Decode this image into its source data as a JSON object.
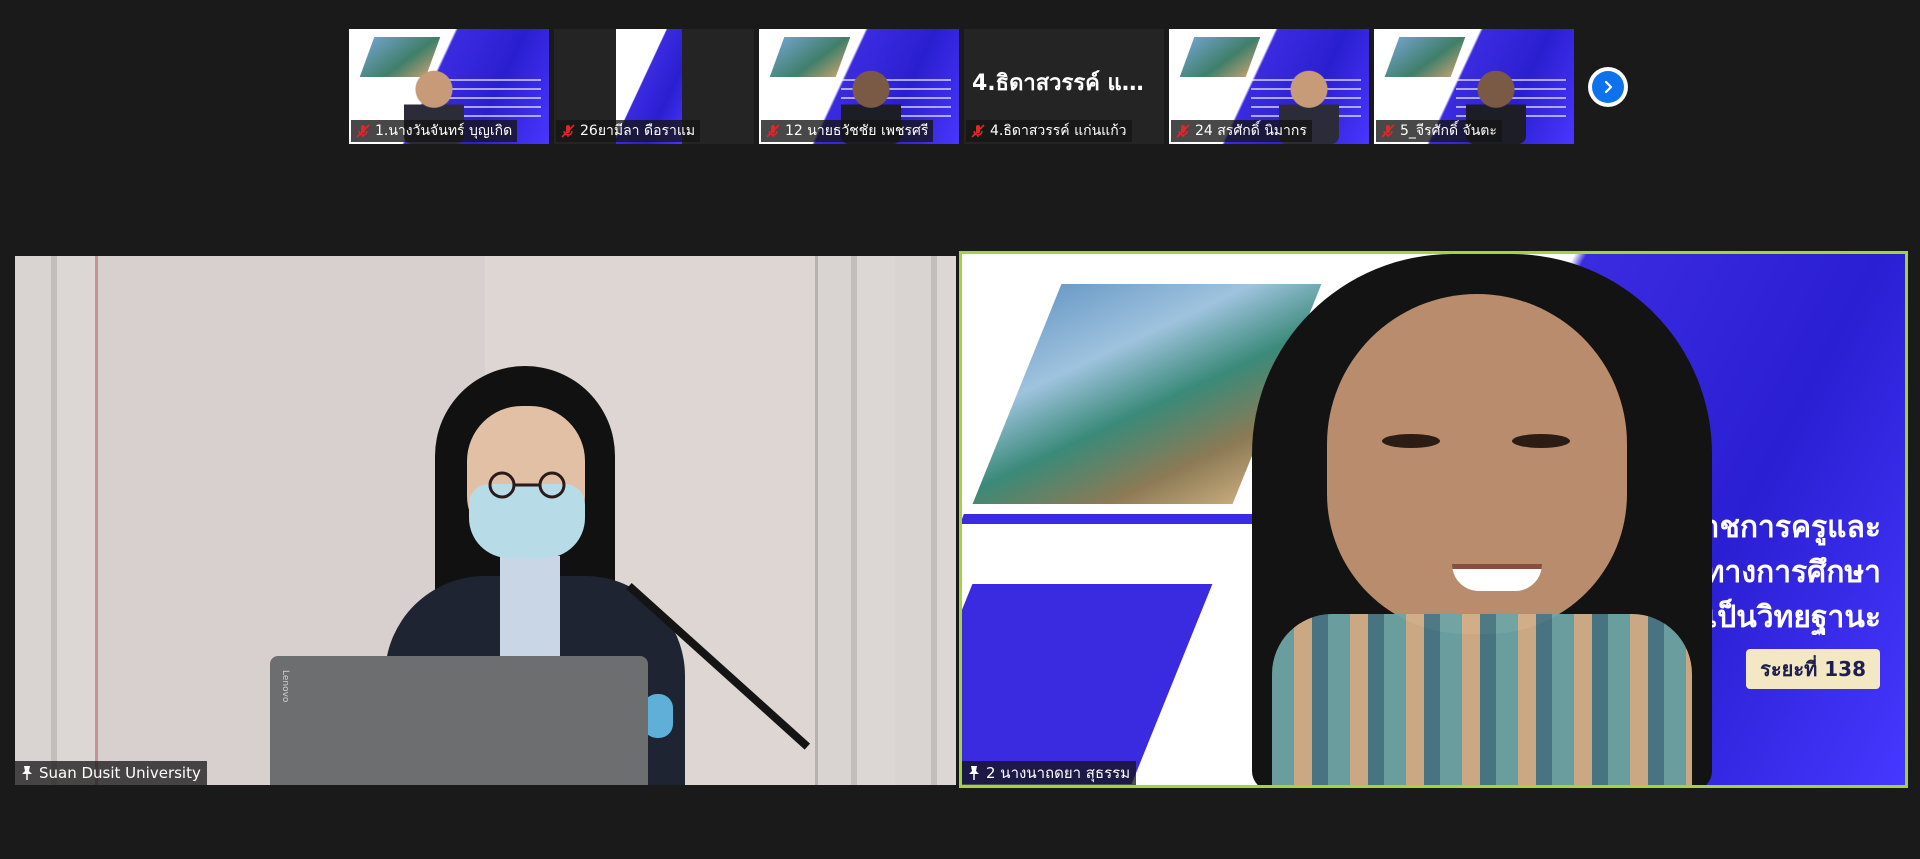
{
  "strip": {
    "participants": [
      {
        "name": "1.นางวันจันทร์ บุญเกิด",
        "mic": "muted-mic-icon"
      },
      {
        "name": "26ยามีลา ดือราแม",
        "mic": "muted-mic-icon"
      },
      {
        "name": "12 นายธวัชชัย เพชรศรี",
        "mic": "muted-mic-icon"
      },
      {
        "name": "4.ธิดาสวรรค์ แก่นแก้ว",
        "mic": "muted-mic-icon",
        "tile_title": "4.ธิดาสวรรค์ แก่..."
      },
      {
        "name": "24 สรศักดิ์ นิมากร",
        "mic": "muted-mic-icon"
      },
      {
        "name": "5_จีรศักดิ์ จันตะ",
        "mic": "muted-mic-icon"
      }
    ],
    "next_button_icon": "chevron-right-icon"
  },
  "main": {
    "left": {
      "name": "Suan Dusit University",
      "icon": "pin-icon",
      "laptop_brand": "Lenovo"
    },
    "right": {
      "name": "2 นางนาถดยา สุธรรม",
      "icon": "pin-icon",
      "active_speaker_color": "#a6d23b",
      "slide": {
        "line1": "ราชการครูและ",
        "line2": "รทางการศึกษา",
        "line3": "มเป็นวิทยฐานะ",
        "pill": "ระยะที่ 138"
      }
    }
  },
  "colors": {
    "background": "#1a1a1a",
    "accent_blue": "#0e72ed",
    "muted_red": "#e02828",
    "slide_blue": "#3b2be0"
  }
}
